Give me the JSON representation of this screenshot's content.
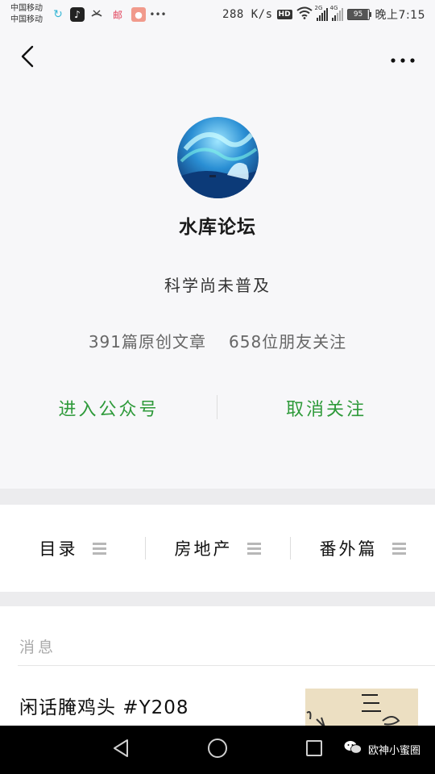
{
  "status_bar": {
    "carrier_1": "中国移动",
    "carrier_2": "中国移动",
    "net_speed": "288 K/s",
    "hd": "HD",
    "signal_1_label": "2G",
    "signal_2_label": "4G",
    "battery": "95",
    "time": "晚上7:15",
    "icons": [
      "sync-icon",
      "tiktok-icon",
      "missed-call-icon",
      "mail-icon",
      "app-icon",
      "more-dots-icon"
    ]
  },
  "nav": {
    "back_icon": "chevron-left-icon",
    "more_icon": "more-horizontal-icon"
  },
  "profile": {
    "name": "水库论坛",
    "description": "科学尚未普及",
    "articles": "391篇原创文章",
    "followers": "658位朋友关注"
  },
  "actions": {
    "enter": "进入公众号",
    "unfollow": "取消关注",
    "accent": "#2e9a3a"
  },
  "menu": {
    "items": [
      {
        "label": "目录"
      },
      {
        "label": "房地产"
      },
      {
        "label": "番外篇"
      }
    ]
  },
  "messages": {
    "label": "消息",
    "latest_title": "闲话腌鸡头 #Y208"
  },
  "system_nav": {
    "watermark": "欧神小蜜圈"
  }
}
